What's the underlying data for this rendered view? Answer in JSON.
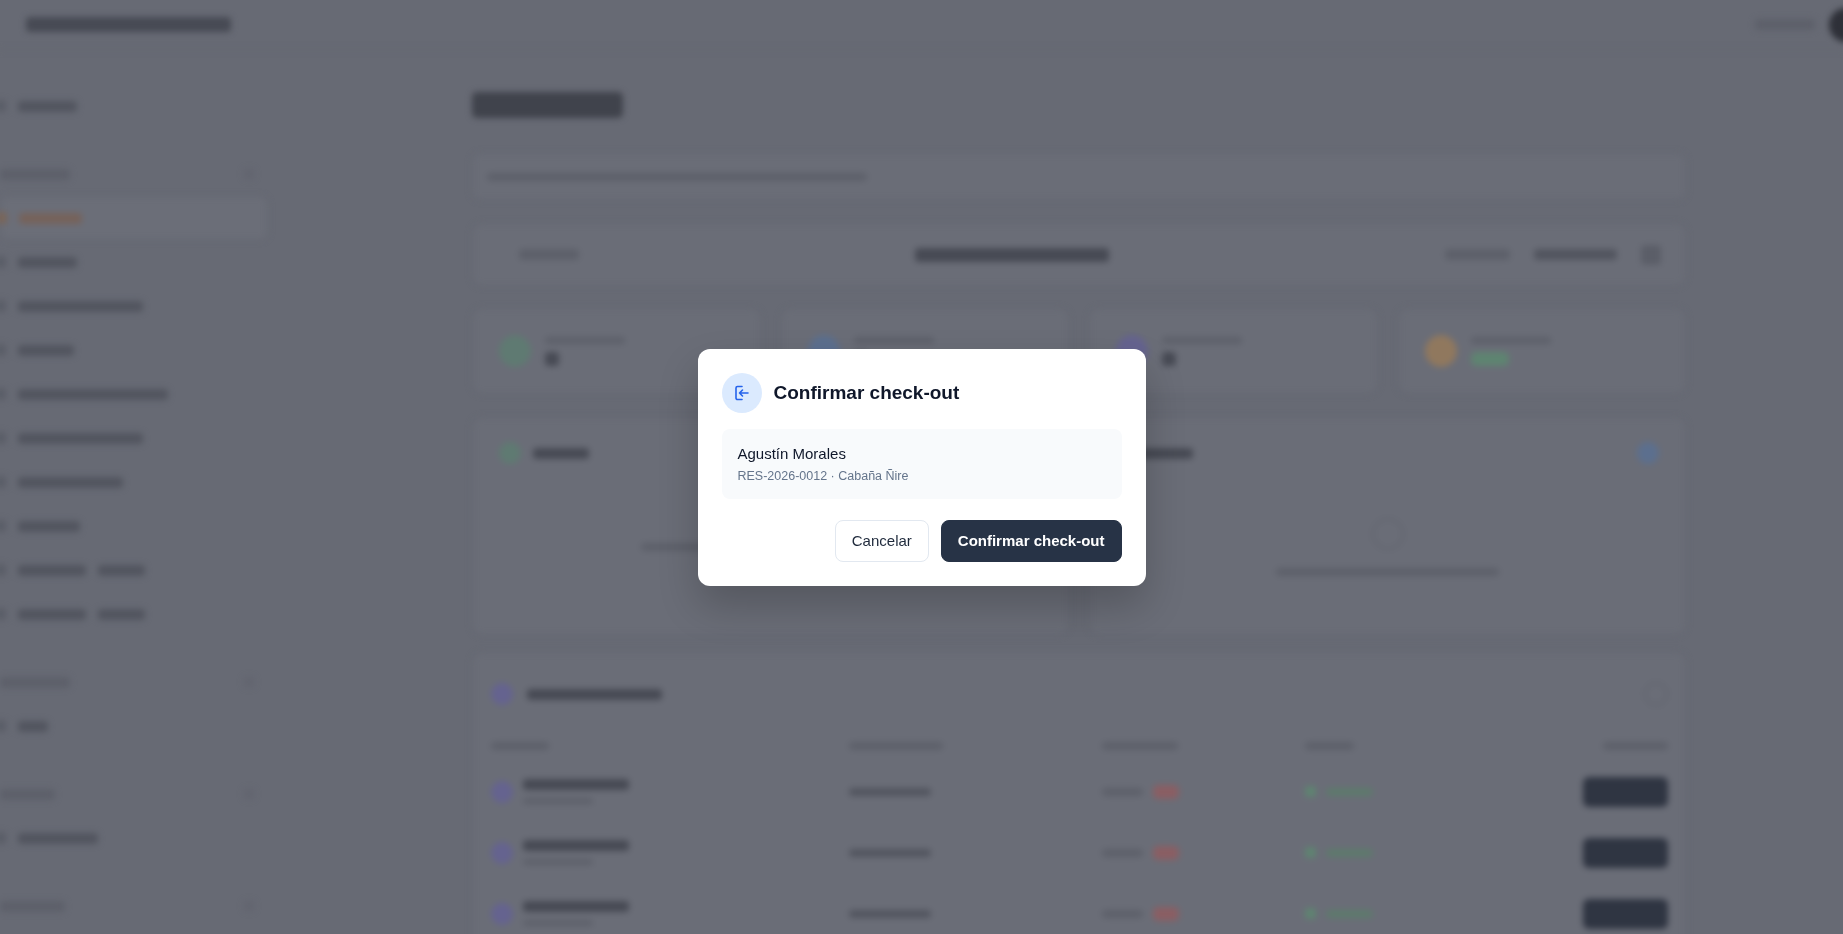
{
  "modal": {
    "title": "Confirmar check-out",
    "guest": {
      "name": "Agustín Morales",
      "detail": "RES-2026-0012 · Cabaña Ñire"
    },
    "buttons": [
      {
        "label": "Cancelar",
        "kind": "secondary"
      },
      {
        "label": "Confirmar check-out",
        "kind": "primary"
      }
    ]
  }
}
